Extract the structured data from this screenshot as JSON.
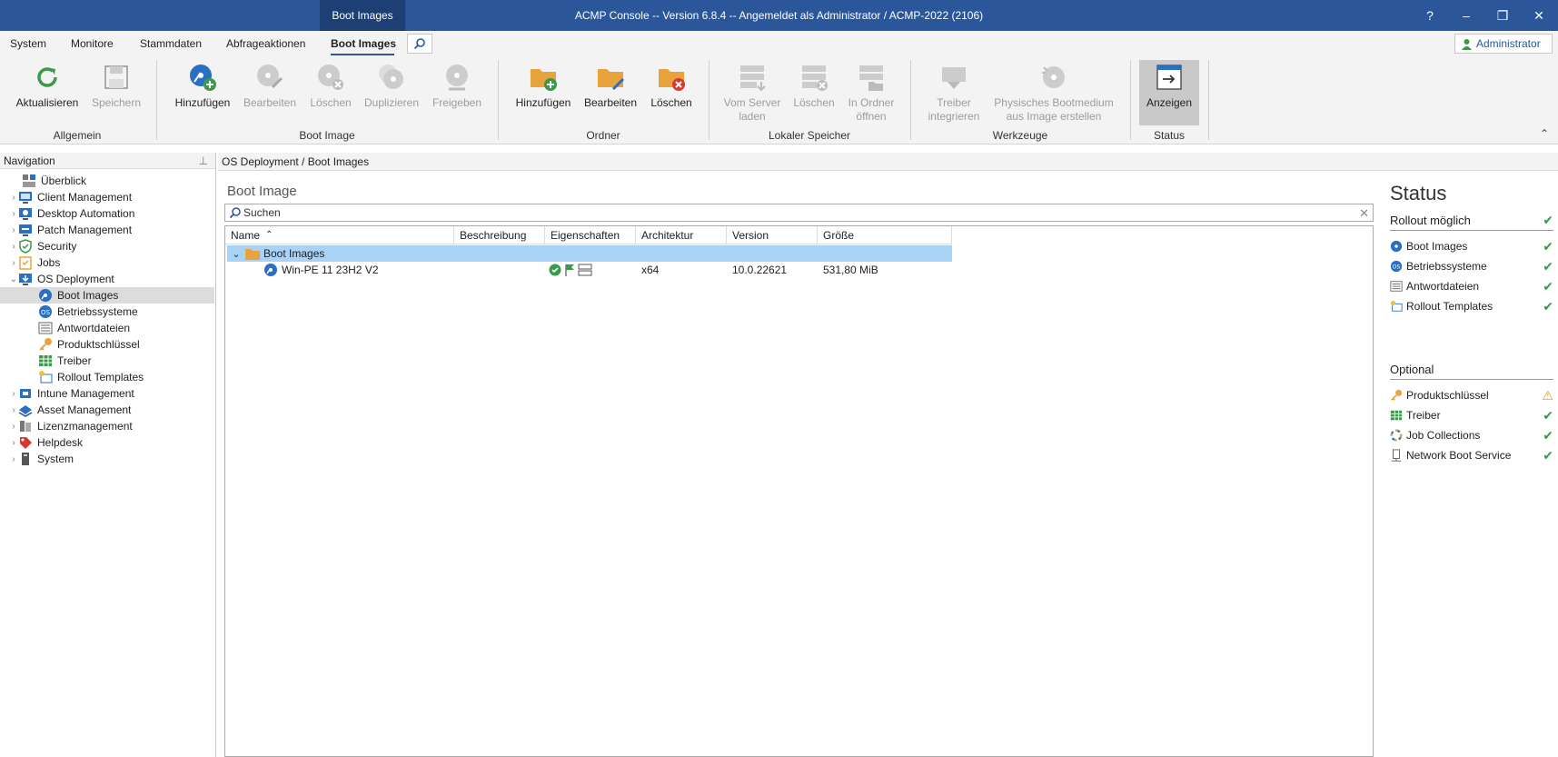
{
  "window": {
    "context_tab": "Boot Images",
    "title": "ACMP Console -- Version 6.8.4 -- Angemeldet als Administrator / ACMP-2022 (2106)",
    "controls": [
      "?",
      "–",
      "❐",
      "✕"
    ]
  },
  "menu": {
    "items": [
      "System",
      "Monitore",
      "Stammdaten",
      "Abfrageaktionen",
      "Boot Images"
    ],
    "active": "Boot Images",
    "user": "Administrator"
  },
  "ribbon": {
    "groups": {
      "allgemein": "Allgemein",
      "boot_image": "Boot Image",
      "ordner": "Ordner",
      "lokaler_speicher": "Lokaler Speicher",
      "werkzeuge": "Werkzeuge",
      "status": "Status"
    },
    "buttons": {
      "aktualisieren": "Aktualisieren",
      "speichern": "Speichern",
      "hinzufuegen": "Hinzufügen",
      "bearbeiten": "Bearbeiten",
      "loeschen": "Löschen",
      "duplizieren": "Duplizieren",
      "freigeben": "Freigeben",
      "ordner_hinzufuegen": "Hinzufügen",
      "ordner_bearbeiten": "Bearbeiten",
      "ordner_loeschen": "Löschen",
      "vom_server_1": "Vom Server",
      "vom_server_2": "laden",
      "lokal_loeschen": "Löschen",
      "in_ordner_1": "In Ordner",
      "in_ordner_2": "öffnen",
      "treiber_1": "Treiber",
      "treiber_2": "integrieren",
      "physisch_1": "Physisches Bootmedium",
      "physisch_2": "aus Image erstellen",
      "anzeigen": "Anzeigen"
    }
  },
  "navigation": {
    "header": "Navigation",
    "items": [
      {
        "label": "Überblick"
      },
      {
        "label": "Client Management"
      },
      {
        "label": "Desktop Automation"
      },
      {
        "label": "Patch Management"
      },
      {
        "label": "Security"
      },
      {
        "label": "Jobs"
      },
      {
        "label": "OS Deployment"
      },
      {
        "label": "Boot Images"
      },
      {
        "label": "Betriebssysteme"
      },
      {
        "label": "Antwortdateien"
      },
      {
        "label": "Produktschlüssel"
      },
      {
        "label": "Treiber"
      },
      {
        "label": "Rollout Templates"
      },
      {
        "label": "Intune Management"
      },
      {
        "label": "Asset Management"
      },
      {
        "label": "Lizenzmanagement"
      },
      {
        "label": "Helpdesk"
      },
      {
        "label": "System"
      }
    ]
  },
  "breadcrumb": "OS Deployment / Boot Images",
  "main": {
    "title": "Boot Image",
    "search_placeholder": "Suchen",
    "columns": [
      "Name",
      "Beschreibung",
      "Eigenschaften",
      "Architektur",
      "Version",
      "Größe"
    ],
    "group": "Boot Images",
    "row": {
      "name": "Win-PE 11 23H2 V2",
      "beschreibung": "",
      "architektur": "x64",
      "version": "10.0.22621",
      "groesse": "531,80 MiB"
    }
  },
  "status": {
    "title": "Status",
    "rollout": "Rollout möglich",
    "rollout_items": [
      {
        "label": "Boot Images",
        "state": "ok"
      },
      {
        "label": "Betriebssysteme",
        "state": "ok"
      },
      {
        "label": "Antwortdateien",
        "state": "ok"
      },
      {
        "label": "Rollout Templates",
        "state": "ok"
      }
    ],
    "optional": "Optional",
    "optional_items": [
      {
        "label": "Produktschlüssel",
        "state": "warning"
      },
      {
        "label": "Treiber",
        "state": "ok"
      },
      {
        "label": "Job Collections",
        "state": "ok"
      },
      {
        "label": "Network Boot Service",
        "state": "ok"
      }
    ]
  },
  "colors": {
    "titlebar": "#2b579a",
    "selection": "#a8d2f6",
    "ok": "#2f9e44",
    "warning": "#e0a000"
  }
}
